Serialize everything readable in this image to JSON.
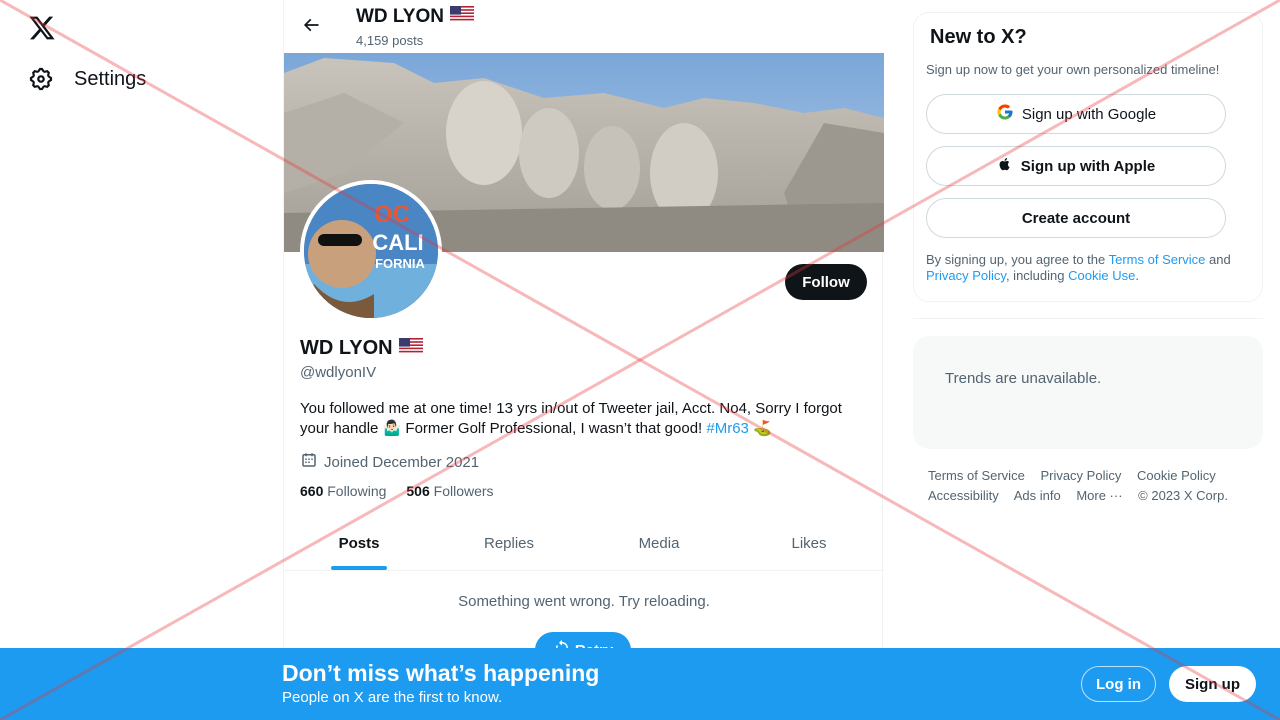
{
  "nav": {
    "settings_label": "Settings"
  },
  "header": {
    "name": "WD LYON",
    "posts_count": "4,159 posts"
  },
  "profile": {
    "name": "WD LYON",
    "handle": "@wdlyonIV",
    "bio_text": "You followed me at one time! 13 yrs in/out of Tweeter jail, Acct. No4, Sorry I forgot your handle 🤷🏻‍♂️ Former Golf Professional, I wasn’t that good! ",
    "bio_hashtag": "#Mr63",
    "bio_end": " ⛳",
    "joined": "Joined December 2021",
    "following_count": "660",
    "following_label": "Following",
    "followers_count": "506",
    "followers_label": "Followers",
    "follow_label": "Follow",
    "avatar_text_top": "OC",
    "avatar_text_mid": "CALI",
    "avatar_text_bottom": "FORNIA"
  },
  "tabs": [
    "Posts",
    "Replies",
    "Media",
    "Likes"
  ],
  "feed": {
    "error_message": "Something went wrong. Try reloading.",
    "retry_label": "Retry"
  },
  "signup": {
    "title": "New to X?",
    "subtitle": "Sign up now to get your own personalized timeline!",
    "google_label": "Sign up with Google",
    "apple_label": "Sign up with Apple",
    "create_label": "Create account",
    "terms_prefix": "By signing up, you agree to the ",
    "terms_link": "Terms of Service",
    "terms_and": " and ",
    "privacy_link": "Privacy Policy",
    "terms_including": ", including ",
    "cookie_link": "Cookie Use",
    "terms_end": "."
  },
  "trends": {
    "message": "Trends are unavailable."
  },
  "footer": {
    "links": [
      "Terms of Service",
      "Privacy Policy",
      "Cookie Policy",
      "Accessibility",
      "Ads info",
      "More ···"
    ],
    "copyright": "© 2023 X Corp."
  },
  "bottom_bar": {
    "headline": "Don’t miss what’s happening",
    "subline": "People on X are the first to know.",
    "login_label": "Log in",
    "signup_label": "Sign up"
  },
  "colors": {
    "accent": "#1d9bf0",
    "text_primary": "#0f1419",
    "text_secondary": "#536471",
    "overlay_red": "#e8353a"
  }
}
